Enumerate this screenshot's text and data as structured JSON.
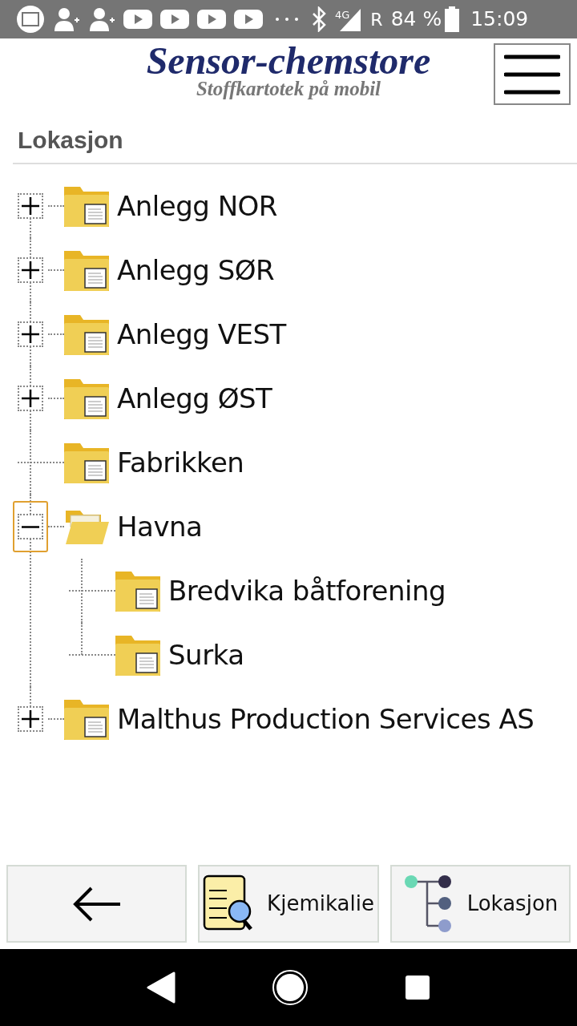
{
  "status_bar": {
    "network": "4G",
    "roaming": "R",
    "battery": "84 %",
    "time": "15:09"
  },
  "header": {
    "logo_title": "Sensor-chemstore",
    "logo_subtitle": "Stoffkartotek på mobil"
  },
  "section_title": "Lokasjon",
  "tree": [
    {
      "label": "Anlegg NOR",
      "expanded": false,
      "selected": false,
      "has_children": true
    },
    {
      "label": "Anlegg SØR",
      "expanded": false,
      "selected": false,
      "has_children": true
    },
    {
      "label": "Anlegg VEST",
      "expanded": false,
      "selected": false,
      "has_children": true
    },
    {
      "label": "Anlegg ØST",
      "expanded": false,
      "selected": false,
      "has_children": true
    },
    {
      "label": "Fabrikken",
      "expanded": false,
      "selected": false,
      "has_children": false
    },
    {
      "label": "Havna",
      "expanded": true,
      "selected": true,
      "has_children": true,
      "children": [
        {
          "label": "Bredvika båtforening",
          "expanded": false,
          "selected": false,
          "has_children": false
        },
        {
          "label": "Surka",
          "expanded": false,
          "selected": false,
          "has_children": false
        }
      ]
    },
    {
      "label": "Malthus Production Services AS",
      "expanded": false,
      "selected": false,
      "has_children": true
    }
  ],
  "bottom_buttons": [
    {
      "kind": "back"
    },
    {
      "kind": "chemical",
      "label": "Kjemikalie"
    },
    {
      "kind": "location",
      "label": "Lokasjon"
    }
  ]
}
